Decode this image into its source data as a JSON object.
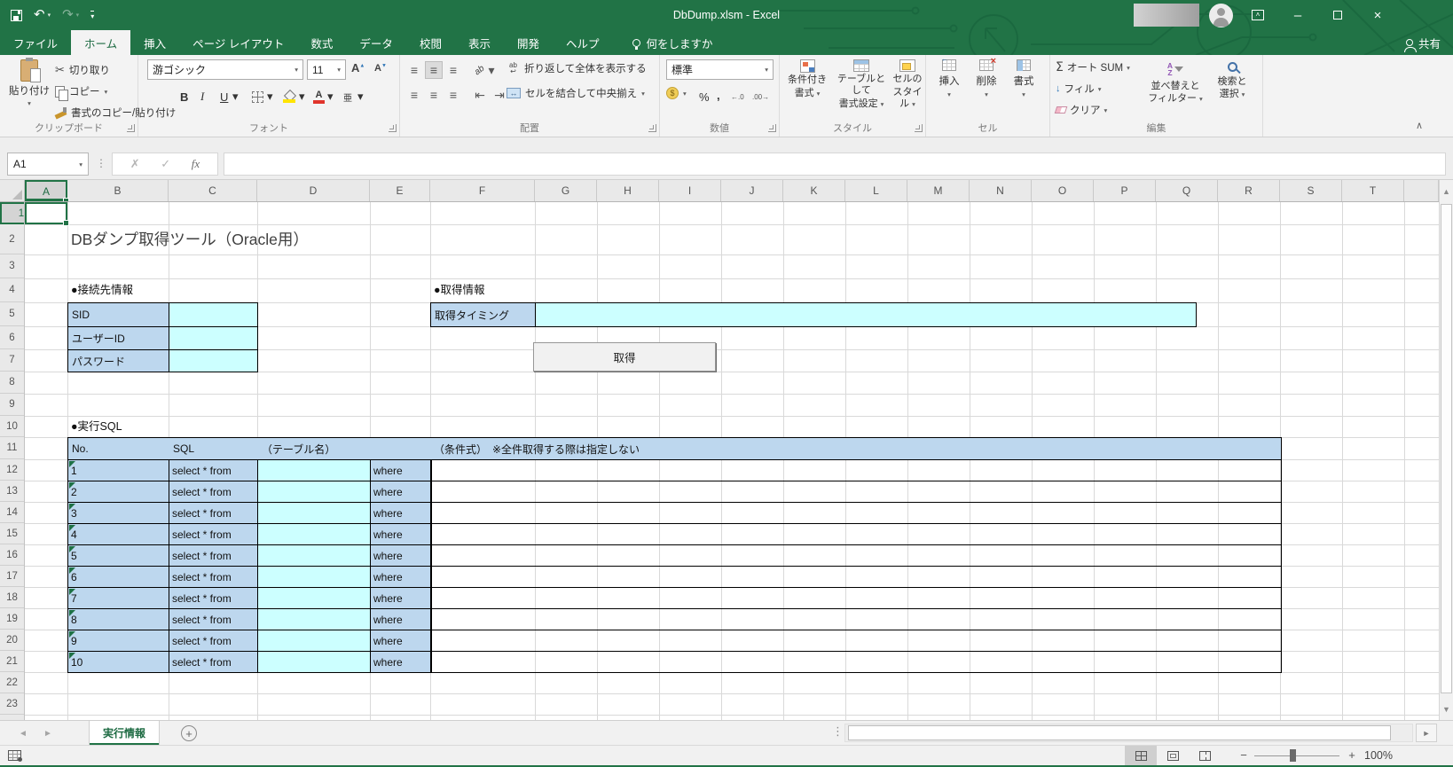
{
  "window": {
    "title": "DbDump.xlsm  -  Excel"
  },
  "tabs": {
    "file": "ファイル",
    "home": "ホーム",
    "insert": "挿入",
    "page_layout": "ページ レイアウト",
    "formulas": "数式",
    "data": "データ",
    "review": "校閲",
    "view": "表示",
    "developer": "開発",
    "help": "ヘルプ",
    "tell_me": "何をしますか",
    "share": "共有"
  },
  "ribbon": {
    "clipboard": {
      "label": "クリップボード",
      "paste": "貼り付け",
      "cut": "切り取り",
      "copy": "コピー",
      "format_painter": "書式のコピー/貼り付け"
    },
    "font": {
      "label": "フォント",
      "family": "游ゴシック",
      "size": "11"
    },
    "alignment": {
      "label": "配置",
      "wrap": "折り返して全体を表示する",
      "merge": "セルを結合して中央揃え"
    },
    "number": {
      "label": "数値",
      "format": "標準"
    },
    "styles": {
      "label": "スタイル",
      "conditional1": "条件付き",
      "conditional2": "書式",
      "table1": "テーブルとして",
      "table2": "書式設定",
      "cell1": "セルの",
      "cell2": "スタイル"
    },
    "cells": {
      "label": "セル",
      "insert": "挿入",
      "delete": "削除",
      "format": "書式"
    },
    "editing": {
      "label": "編集",
      "autosum": "オート SUM",
      "fill": "フィル",
      "clear": "クリア",
      "sort1": "並べ替えと",
      "sort2": "フィルター",
      "find1": "検索と",
      "find2": "選択"
    },
    "glyphs": {
      "bold": "B",
      "italic": "I",
      "underline": "U",
      "percent": "%",
      "comma": ",",
      "sigma": "Σ",
      "ruby": "亜",
      "dec_left": "←.0",
      "dec_right": ".00→"
    }
  },
  "formula_bar": {
    "name_box": "A1",
    "fx": "fx"
  },
  "sheet": {
    "columns": [
      "A",
      "B",
      "C",
      "D",
      "E",
      "F",
      "G",
      "H",
      "I",
      "J",
      "K",
      "L",
      "M",
      "N",
      "O",
      "P",
      "Q",
      "R",
      "S",
      "T"
    ],
    "row_count": 23,
    "title": "DBダンプ取得ツール（Oracle用）",
    "connection": {
      "heading": "●接続先情報",
      "rows": [
        {
          "label": "SID",
          "value": ""
        },
        {
          "label": "ユーザーID",
          "value": ""
        },
        {
          "label": "パスワード",
          "value": ""
        }
      ]
    },
    "acquisition": {
      "heading": "●取得情報",
      "timing_label": "取得タイミング",
      "timing_value": "",
      "button": "取得"
    },
    "sql": {
      "heading": "●実行SQL",
      "header": {
        "no": "No.",
        "sql": "SQL",
        "table": "（テーブル名）",
        "condition": "（条件式）　※全件取得する際は指定しない"
      },
      "rows": [
        {
          "no": "1",
          "sql": "select * from",
          "table": "",
          "where": "where",
          "condition": ""
        },
        {
          "no": "2",
          "sql": "select * from",
          "table": "",
          "where": "where",
          "condition": ""
        },
        {
          "no": "3",
          "sql": "select * from",
          "table": "",
          "where": "where",
          "condition": ""
        },
        {
          "no": "4",
          "sql": "select * from",
          "table": "",
          "where": "where",
          "condition": ""
        },
        {
          "no": "5",
          "sql": "select * from",
          "table": "",
          "where": "where",
          "condition": ""
        },
        {
          "no": "6",
          "sql": "select * from",
          "table": "",
          "where": "where",
          "condition": ""
        },
        {
          "no": "7",
          "sql": "select * from",
          "table": "",
          "where": "where",
          "condition": ""
        },
        {
          "no": "8",
          "sql": "select * from",
          "table": "",
          "where": "where",
          "condition": ""
        },
        {
          "no": "9",
          "sql": "select * from",
          "table": "",
          "where": "where",
          "condition": ""
        },
        {
          "no": "10",
          "sql": "select * from",
          "table": "",
          "where": "where",
          "condition": ""
        }
      ]
    }
  },
  "tabbar": {
    "sheet": "実行情報"
  },
  "statusbar": {
    "zoom": "100%"
  },
  "colors": {
    "accent": "#217346",
    "header_fill": "#BDD7EE",
    "input_fill": "#CCFFFF"
  }
}
